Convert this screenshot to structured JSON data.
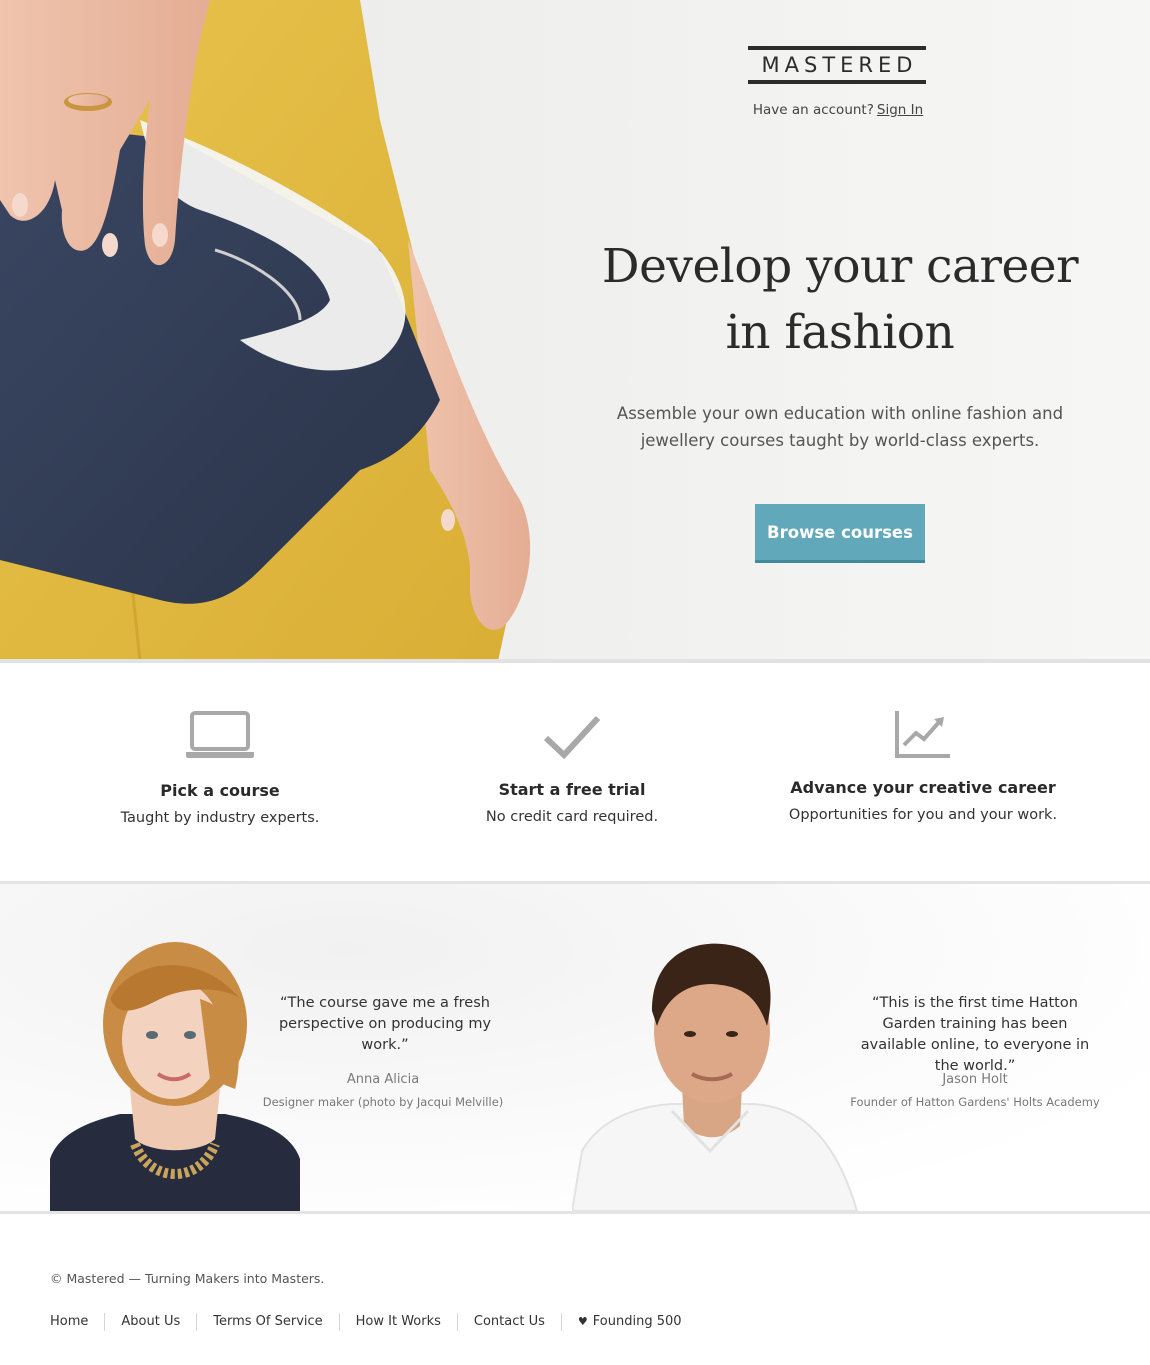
{
  "brand": {
    "logo_text": "MASTERED"
  },
  "header": {
    "account_prompt": "Have an account?",
    "sign_in_label": "Sign In"
  },
  "hero": {
    "headline_line1": "Develop your career",
    "headline_line2": "in fashion",
    "subhead": "Assemble your own education with online fashion and jewellery courses taught by world-class experts.",
    "cta_label": "Browse courses",
    "cta_color": "#62a8bb"
  },
  "features": [
    {
      "icon": "laptop-icon",
      "title": "Pick a course",
      "description": "Taught by industry experts."
    },
    {
      "icon": "checkmark-icon",
      "title": "Start a free trial",
      "description": "No credit card required."
    },
    {
      "icon": "growth-chart-icon",
      "title": "Advance your creative career",
      "description": "Opportunities for you and your work."
    }
  ],
  "testimonials": [
    {
      "quote": "“The course gave me a fresh perspective on producing my work.”",
      "name": "Anna Alicia",
      "role": "Designer maker (photo by Jacqui Melville)"
    },
    {
      "quote": "“This is the first time Hatton Garden training has been available online, to everyone in the world.”",
      "name": "Jason Holt",
      "role": "Founder of Hatton Gardens' Holts Academy"
    }
  ],
  "footer": {
    "copyright": "© Mastered — Turning Makers into Masters.",
    "links": [
      "Home",
      "About Us",
      "Terms Of Service",
      "How It Works",
      "Contact Us",
      "Founding 500"
    ],
    "heart_symbol": "♥"
  }
}
